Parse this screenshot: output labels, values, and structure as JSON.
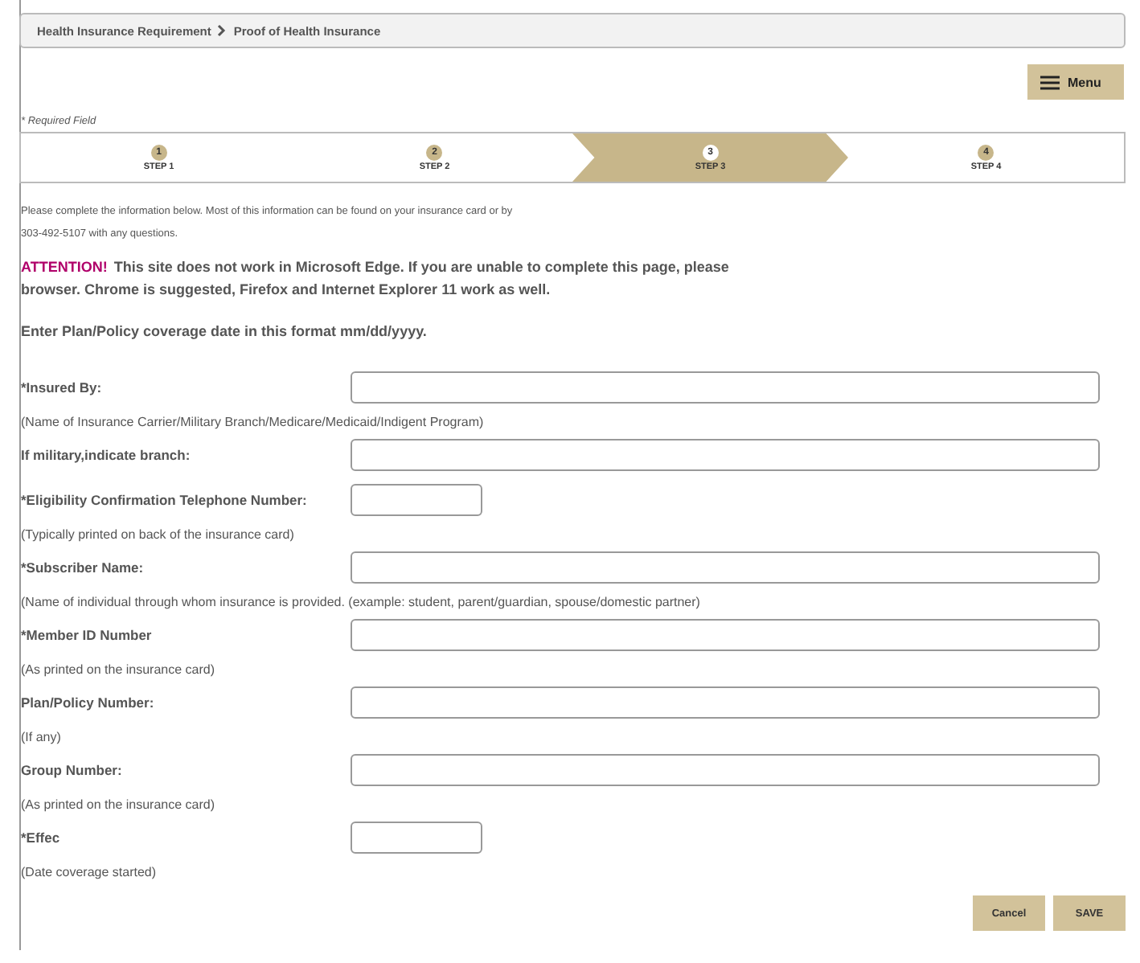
{
  "breadcrumb": [
    {
      "label": "Health Insurance Requirement"
    },
    {
      "label": "Proof of Health Insurance"
    }
  ],
  "menu_button": {
    "label": "Menu"
  },
  "required_note": "* Required Field",
  "steps": [
    {
      "number": "1",
      "label": "STEP 1",
      "selected": false
    },
    {
      "number": "2",
      "label": "STEP 2",
      "selected": false
    },
    {
      "number": "3",
      "label": "STEP 3",
      "selected": true
    },
    {
      "number": "4",
      "label": "STEP 4",
      "selected": false
    }
  ],
  "instructions": [
    "Please complete the information below. Most of this information can be found on your insurance card or by",
    "303-492-5107 with any questions."
  ],
  "attention": {
    "label": "ATTENTION!",
    "text": "This site does not work in Microsoft Edge.  If you are unable to complete this page, please",
    "text_2": "browser.  Chrome is suggested, Firefox and Internet Explorer 11 work as well."
  },
  "date_note": "Enter Plan/Policy coverage date in this format mm/dd/yyyy.",
  "fields": [
    {
      "label": "*Insured By:",
      "kind": "long",
      "hint": "(Name of Insurance Carrier/Military Branch/Medicare/Medicaid/Indigent Program)"
    },
    {
      "label": "If military,indicate branch:",
      "kind": "long"
    },
    {
      "label": "*Eligibility Confirmation Telephone Number:",
      "kind": "short",
      "hint": "(Typically printed on back of the insurance card)"
    },
    {
      "label": "*Subscriber Name:",
      "kind": "long",
      "hint": "(Name of individual through whom insurance is provided. (example: student, parent/guardian, spouse/domestic partner)"
    },
    {
      "label": "*Member ID Number",
      "kind": "long",
      "hint": "(As printed on the insurance card)"
    },
    {
      "label": "Plan/Policy Number:",
      "kind": "long",
      "hint": "(If any)"
    },
    {
      "label": "Group Number:",
      "kind": "long",
      "hint": "(As printed on the insurance card)"
    },
    {
      "label": "*Effec",
      "kind": "short",
      "hint": "(Date coverage started)"
    }
  ],
  "buttons": [
    {
      "label": "Cancel"
    },
    {
      "label": "SAVE"
    }
  ]
}
